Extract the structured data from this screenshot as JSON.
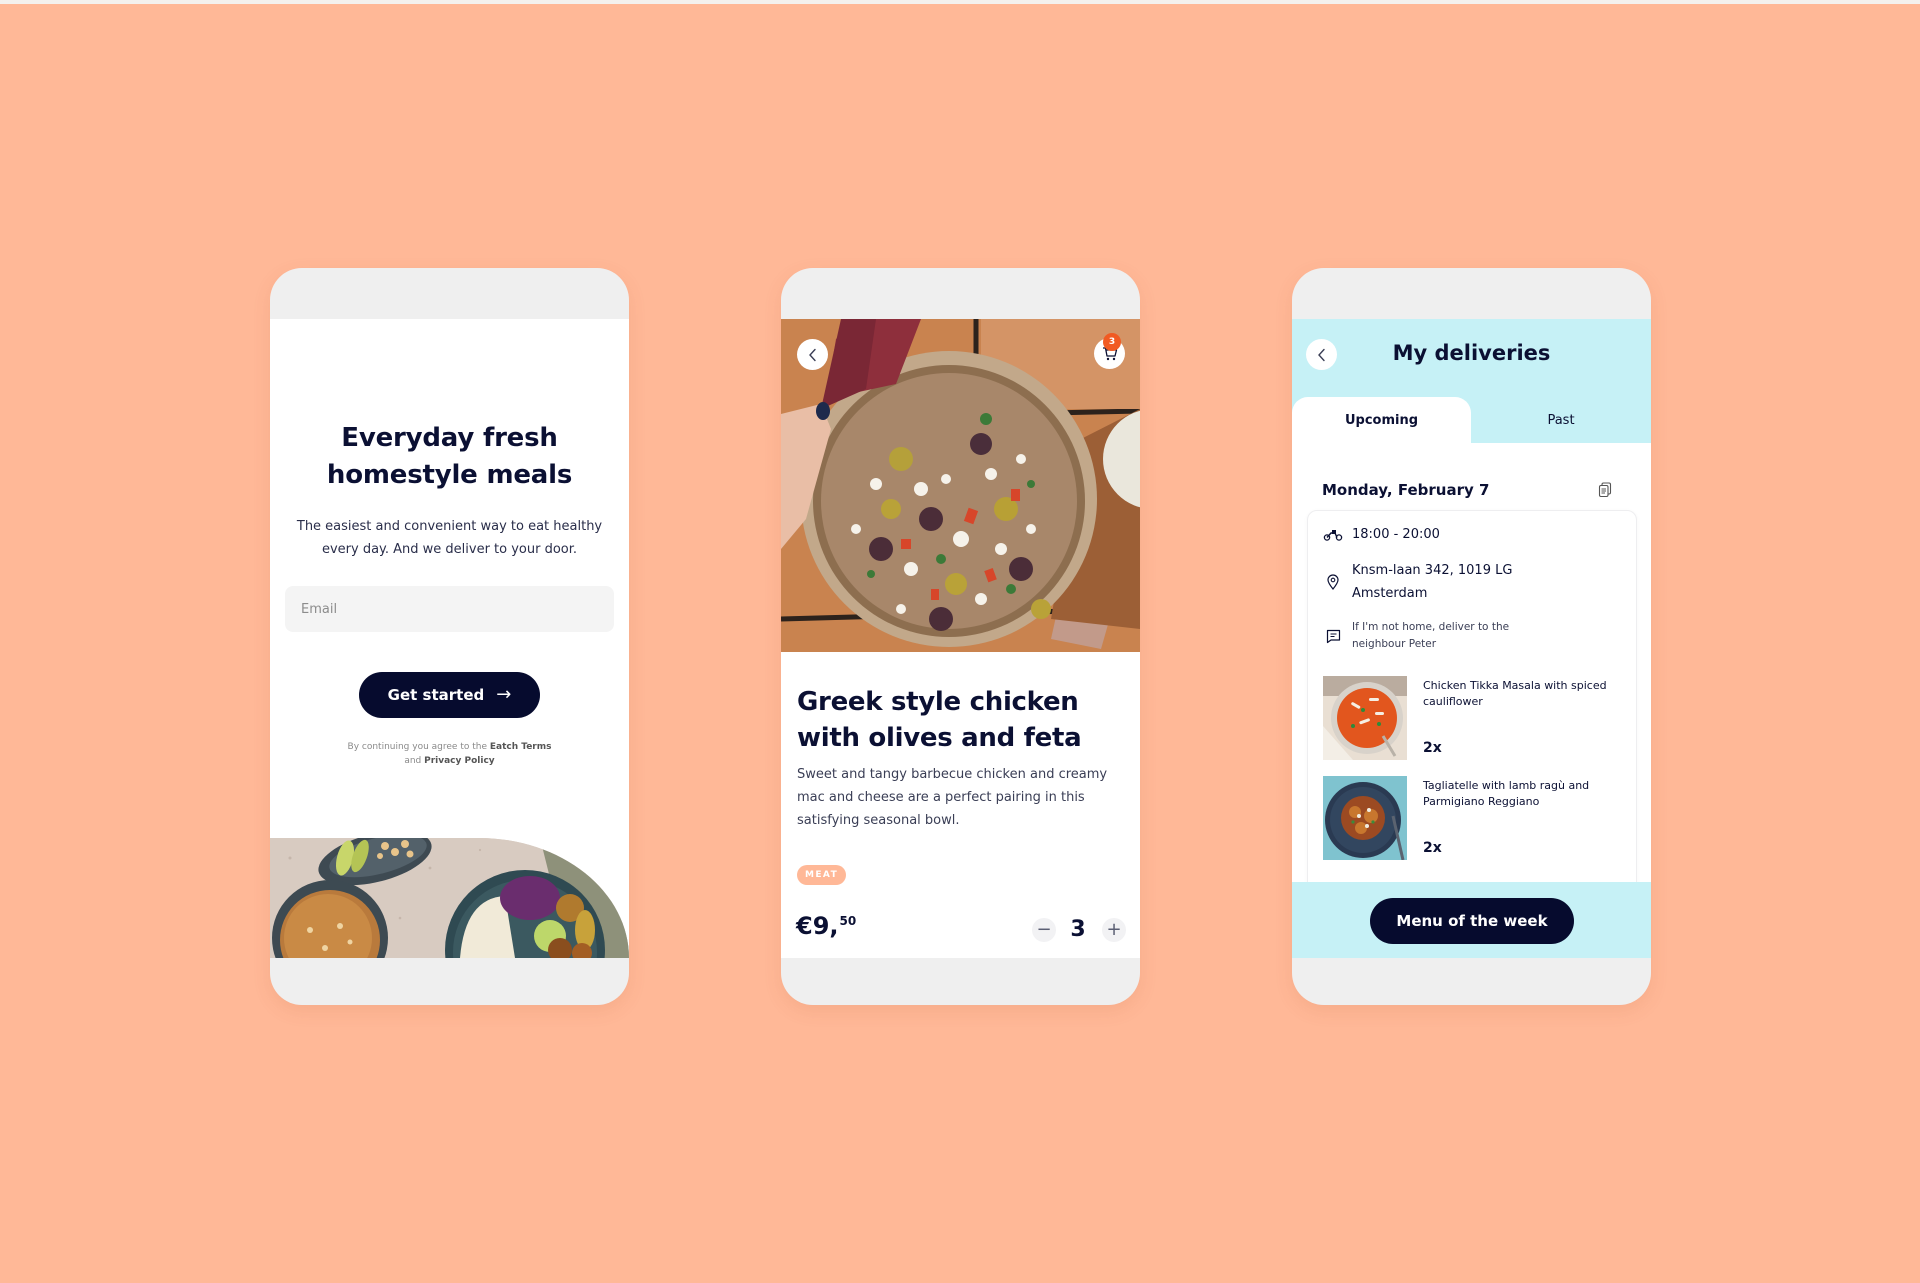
{
  "colors": {
    "background": "#FFB897",
    "navy": "#060B2E",
    "cyan": "#C6F1F6",
    "badge": "#F15A22",
    "tag": "#FFB897"
  },
  "onboarding": {
    "title_line1": "Everyday fresh",
    "title_line2": "homestyle meals",
    "subtitle": "The easiest and convenient way to eat healthy every day. And we deliver to your door.",
    "email_placeholder": "Email",
    "email_value": "",
    "cta_label": "Get started",
    "cta_icon": "arrow-right-icon",
    "terms_prefix": "By continuing you agree to the",
    "terms_link": "Eatch Terms",
    "terms_and": "and",
    "privacy_link": "Privacy Policy"
  },
  "product": {
    "back_icon": "chevron-left-icon",
    "cart_icon": "cart-icon",
    "cart_count": "3",
    "title_line1": "Greek style chicken",
    "title_line2": "with olives and feta",
    "description": "Sweet and tangy barbecue chicken and creamy mac and cheese are a perfect pairing in this satisfying seasonal bowl.",
    "tag": "MEAT",
    "price_main": "€9,",
    "price_cents": "50",
    "quantity": "3",
    "minus_label": "−",
    "plus_label": "+"
  },
  "deliveries": {
    "title": "My deliveries",
    "tabs": [
      {
        "label": "Upcoming",
        "active": true
      },
      {
        "label": "Past",
        "active": false
      }
    ],
    "date": "Monday, February 7",
    "time": "18:00 - 20:00",
    "address_line1": "Knsm-laan 342, 1019 LG",
    "address_line2": "Amsterdam",
    "note_line1": "If I'm not home, deliver to the",
    "note_line2": "neighbour Peter",
    "meals": [
      {
        "name": "Chicken Tikka Masala with spiced cauliflower",
        "qty": "2x"
      },
      {
        "name": "Tagliatelle with lamb ragù and Parmigiano Reggiano",
        "qty": "2x"
      }
    ],
    "footer_button": "Menu of the week"
  }
}
